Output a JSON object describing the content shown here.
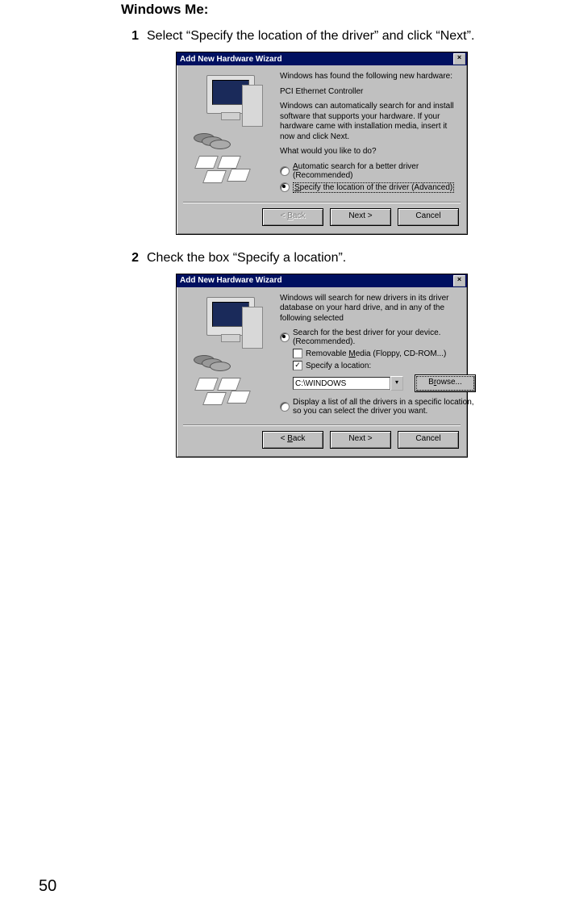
{
  "heading": "Windows Me:",
  "page_number": "50",
  "steps": [
    {
      "num": "1",
      "text": "Select “Specify the location of the driver” and click “Next”."
    },
    {
      "num": "2",
      "text": "Check the box “Specify a location”."
    }
  ],
  "dialog1": {
    "title": "Add New Hardware Wizard",
    "intro": "Windows has found the following new hardware:",
    "device": "PCI Ethernet Controller",
    "desc": "Windows can automatically search for and install software that supports your hardware. If your hardware came with installation media, insert it now and click Next.",
    "question": "What would you like to do?",
    "opt_auto": "utomatic search for a better driver (Recommended)",
    "opt_spec": "pecify the location of the driver (Advanced)",
    "btn_back": "ack",
    "btn_next": "Next",
    "btn_cancel": "Cancel"
  },
  "dialog2": {
    "title": "Add New Hardware Wizard",
    "intro": "Windows will search for new drivers in its driver database on your hard drive, and in any of the following selected",
    "opt_search": "Search for the best driver for your device. (Recommended).",
    "chk_removable": "edia (Floppy, CD-ROM...)",
    "chk_specify": "Specify a location:",
    "path_value": "C:\\WINDOWS",
    "btn_browse": "owse...",
    "opt_list": "Display a list of all the drivers in a specific location, so you can select the driver you want.",
    "btn_back": "ack",
    "btn_next": "Next",
    "btn_cancel": "Cancel"
  }
}
